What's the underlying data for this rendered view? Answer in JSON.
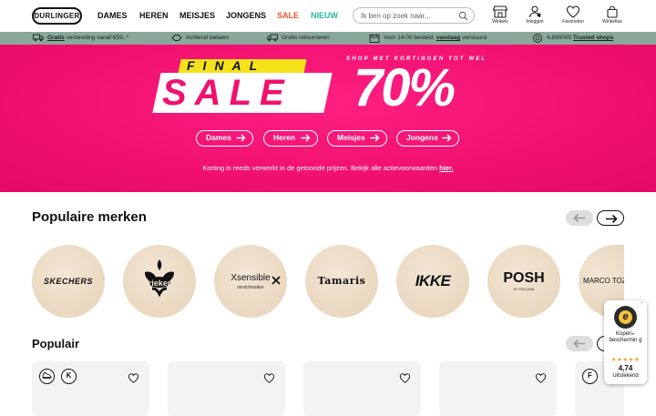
{
  "header": {
    "logo": "DURLINGER",
    "nav": [
      "DAMES",
      "HEREN",
      "MEISJES",
      "JONGENS",
      "SALE",
      "NIEUW"
    ],
    "search_placeholder": "Ik ben op zoek naar...",
    "icons": [
      {
        "label": "Winkels",
        "icon": "store-icon"
      },
      {
        "label": "Inloggen",
        "icon": "user-icon"
      },
      {
        "label": "Favorieten",
        "icon": "heart-icon"
      },
      {
        "label": "Winkeltas",
        "icon": "bag-icon"
      }
    ]
  },
  "usp": {
    "shipping_bold": "Gratis",
    "shipping_rest": " verzending vanaf €59,-*",
    "afterpay": "Achteraf betalen",
    "returns": "Gratis retourneren",
    "order_pre": "Voor 14:00 besteld, ",
    "order_bold": "vandaag",
    "order_post": " verstuurd",
    "trusted_pre": "4,690000 ",
    "trusted_bold": "Trusted shops"
  },
  "banner": {
    "final": "FINAL",
    "sale": "SALE",
    "tagline": "SHOP MET KORTINGEN TOT WEL",
    "percent": "70%",
    "buttons": [
      "Dames",
      "Heren",
      "Meisjes",
      "Jongens"
    ],
    "note": "Korting is reeds verwerkt in de getoonde prijzen. Bekijk alle actievoorwaarden ",
    "note_link": "hier."
  },
  "brands": {
    "title": "Populaire merken",
    "items": [
      "SKECHERS",
      "rieker",
      "Xsensible",
      "Tamaris",
      "IKKE",
      "POSH",
      "MARCO TOZZI"
    ],
    "xsensible_sub": "stretchwalker",
    "posh_sub": "BY POELMAN"
  },
  "popular": {
    "title": "Populair",
    "tags": [
      "K",
      "F"
    ]
  },
  "trust": {
    "seal": "e",
    "label": "Kopers-beschermin g",
    "stars": "★★★★★",
    "score": "4,74",
    "rating": "Uitstekend"
  },
  "colors": {
    "banner_pink": "#f0106f",
    "final_yellow": "#f5e21b",
    "usp_green": "#8aa899",
    "sale_orange": "#e8542b",
    "nieuw_teal": "#2bb5a0"
  }
}
